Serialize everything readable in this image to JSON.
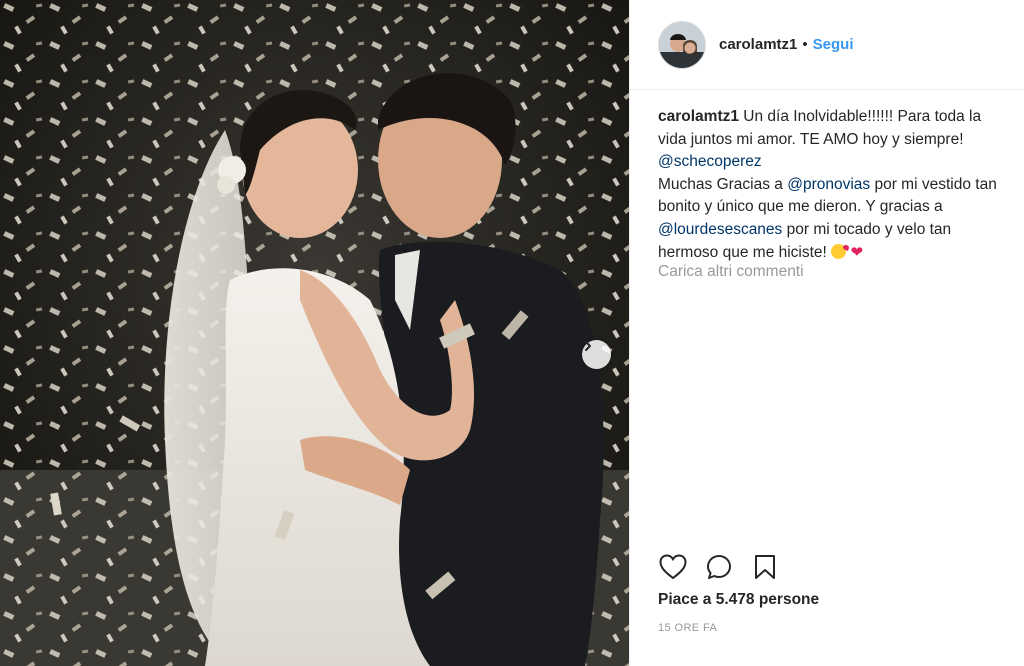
{
  "post": {
    "username": "carolamtz1",
    "separator": "•",
    "follow_label": "Segui",
    "photo_description_icon": "photo",
    "next_icon": "chevron-right-icon"
  },
  "caption": {
    "username": "carolamtz1",
    "part1": " Un día Inolvidable!!!!!! Para toda la vida juntos mi amor. TE AMO hoy y siempre! ",
    "mention1": "@schecoperez",
    "part2": "Muchas Gracias a ",
    "mention2": "@pronovias",
    "part3": " por mi vestido tan bonito y único que me dieron. Y gracias a ",
    "mention3": "@lourdesescanes",
    "part4": " por mi tocado y velo tan hermoso que me hiciste! ",
    "emojis": [
      "kiss-emoji",
      "heart-emoji"
    ],
    "heart": "❤"
  },
  "comments": {
    "load_more": "Carica altri commenti"
  },
  "actions": {
    "icons": [
      "heart-icon",
      "comment-icon",
      "bookmark-icon"
    ]
  },
  "likes": {
    "text": "Piace a 5.478 persone"
  },
  "timestamp": "15 ORE FA",
  "colors": {
    "link": "#3897f0",
    "mention": "#003569",
    "muted": "#999999",
    "text": "#262626"
  }
}
